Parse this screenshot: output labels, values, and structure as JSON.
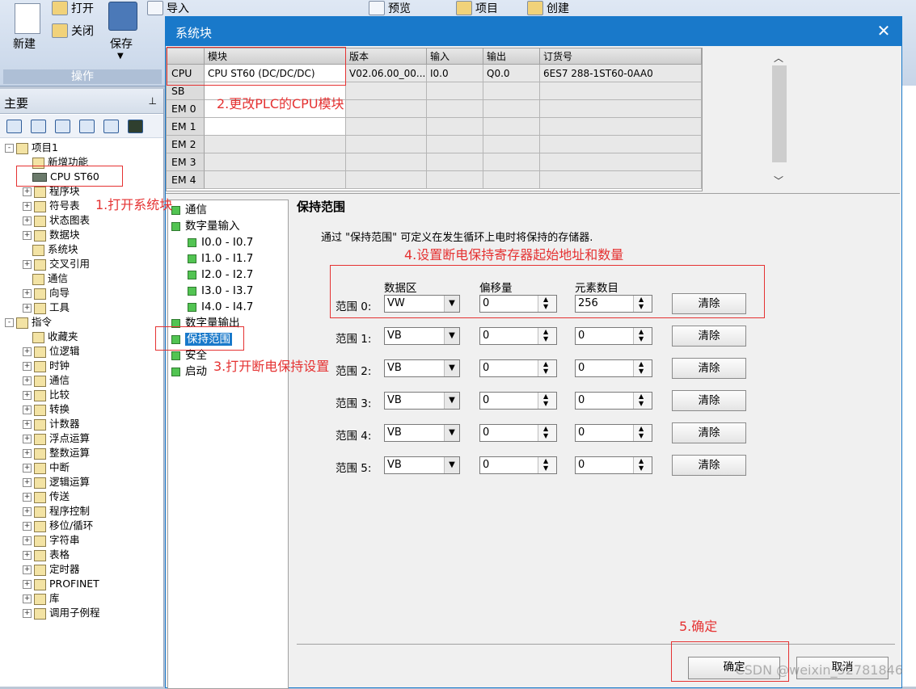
{
  "ribbon": {
    "new_label": "新建",
    "open_label": "打开",
    "close_label": "关闭",
    "save_label": "保存",
    "import_label": "导入",
    "preview_label": "预览",
    "project_label": "项目",
    "create_label": "创建",
    "group_label": "操作"
  },
  "left_panel": {
    "title": "主要",
    "tree": [
      {
        "label": "项目1",
        "indent": 0,
        "exp": "-"
      },
      {
        "label": "新增功能",
        "indent": 2,
        "exp": ""
      },
      {
        "label": "CPU ST60",
        "indent": 2,
        "exp": ""
      },
      {
        "label": "程序块",
        "indent": 1,
        "exp": "+"
      },
      {
        "label": "符号表",
        "indent": 1,
        "exp": "+"
      },
      {
        "label": "状态图表",
        "indent": 1,
        "exp": "+"
      },
      {
        "label": "数据块",
        "indent": 1,
        "exp": "+"
      },
      {
        "label": "系统块",
        "indent": 2,
        "exp": ""
      },
      {
        "label": "交叉引用",
        "indent": 1,
        "exp": "+"
      },
      {
        "label": "通信",
        "indent": 2,
        "exp": ""
      },
      {
        "label": "向导",
        "indent": 1,
        "exp": "+"
      },
      {
        "label": "工具",
        "indent": 1,
        "exp": "+"
      },
      {
        "label": "指令",
        "indent": 0,
        "exp": "-"
      },
      {
        "label": "收藏夹",
        "indent": 2,
        "exp": ""
      },
      {
        "label": "位逻辑",
        "indent": 1,
        "exp": "+"
      },
      {
        "label": "时钟",
        "indent": 1,
        "exp": "+"
      },
      {
        "label": "通信",
        "indent": 1,
        "exp": "+"
      },
      {
        "label": "比较",
        "indent": 1,
        "exp": "+"
      },
      {
        "label": "转换",
        "indent": 1,
        "exp": "+"
      },
      {
        "label": "计数器",
        "indent": 1,
        "exp": "+"
      },
      {
        "label": "浮点运算",
        "indent": 1,
        "exp": "+"
      },
      {
        "label": "整数运算",
        "indent": 1,
        "exp": "+"
      },
      {
        "label": "中断",
        "indent": 1,
        "exp": "+"
      },
      {
        "label": "逻辑运算",
        "indent": 1,
        "exp": "+"
      },
      {
        "label": "传送",
        "indent": 1,
        "exp": "+"
      },
      {
        "label": "程序控制",
        "indent": 1,
        "exp": "+"
      },
      {
        "label": "移位/循环",
        "indent": 1,
        "exp": "+"
      },
      {
        "label": "字符串",
        "indent": 1,
        "exp": "+"
      },
      {
        "label": "表格",
        "indent": 1,
        "exp": "+"
      },
      {
        "label": "定时器",
        "indent": 1,
        "exp": "+"
      },
      {
        "label": "PROFINET",
        "indent": 1,
        "exp": "+"
      },
      {
        "label": "库",
        "indent": 1,
        "exp": "+"
      },
      {
        "label": "调用子例程",
        "indent": 1,
        "exp": "+"
      }
    ]
  },
  "dialog": {
    "title": "系统块",
    "grid": {
      "headers": [
        "模块",
        "版本",
        "输入",
        "输出",
        "订货号"
      ],
      "rows": [
        {
          "slot": "CPU",
          "cells": [
            "CPU ST60 (DC/DC/DC)",
            "V02.06.00_00....",
            "I0.0",
            "Q0.0",
            "6ES7 288-1ST60-0AA0"
          ]
        },
        {
          "slot": "SB",
          "cells": [
            "",
            "",
            "",
            "",
            ""
          ]
        },
        {
          "slot": "EM 0",
          "cells": [
            "",
            "",
            "",
            "",
            ""
          ]
        },
        {
          "slot": "EM 1",
          "cells": [
            "",
            "",
            "",
            "",
            ""
          ]
        },
        {
          "slot": "EM 2",
          "cells": [
            "",
            "",
            "",
            "",
            ""
          ]
        },
        {
          "slot": "EM 3",
          "cells": [
            "",
            "",
            "",
            "",
            ""
          ]
        },
        {
          "slot": "EM 4",
          "cells": [
            "",
            "",
            "",
            "",
            ""
          ]
        }
      ]
    },
    "nav": [
      {
        "label": "通信",
        "level": 0,
        "selected": false
      },
      {
        "label": "数字量输入",
        "level": 0,
        "selected": false
      },
      {
        "label": "I0.0 - I0.7",
        "level": 1,
        "selected": false
      },
      {
        "label": "I1.0 - I1.7",
        "level": 1,
        "selected": false
      },
      {
        "label": "I2.0 - I2.7",
        "level": 1,
        "selected": false
      },
      {
        "label": "I3.0 - I3.7",
        "level": 1,
        "selected": false
      },
      {
        "label": "I4.0 - I4.7",
        "level": 1,
        "selected": false
      },
      {
        "label": "数字量输出",
        "level": 0,
        "selected": false
      },
      {
        "label": "保持范围",
        "level": 0,
        "selected": true
      },
      {
        "label": "安全",
        "level": 0,
        "selected": false
      },
      {
        "label": "启动",
        "level": 0,
        "selected": false
      }
    ],
    "content": {
      "title": "保持范围",
      "description": "通过 \"保持范围\" 可定义在发生循环上电时将保持的存储器.",
      "col_area": "数据区",
      "col_offset": "偏移量",
      "col_count": "元素数目",
      "clear_label": "清除",
      "ranges": [
        {
          "label": "范围 0:",
          "area": "VW",
          "offset": "0",
          "count": "256"
        },
        {
          "label": "范围 1:",
          "area": "VB",
          "offset": "0",
          "count": "0"
        },
        {
          "label": "范围 2:",
          "area": "VB",
          "offset": "0",
          "count": "0"
        },
        {
          "label": "范围 3:",
          "area": "VB",
          "offset": "0",
          "count": "0"
        },
        {
          "label": "范围 4:",
          "area": "VB",
          "offset": "0",
          "count": "0"
        },
        {
          "label": "范围 5:",
          "area": "VB",
          "offset": "0",
          "count": "0"
        }
      ]
    },
    "ok_label": "确定",
    "cancel_label": "取消"
  },
  "annotations": {
    "step1": "1.打开系统块",
    "step2": "2.更改PLC的CPU模块",
    "step3": "3.打开断电保持设置",
    "step4": "4.设置断电保持寄存器起始地址和数量",
    "step5": "5.确定",
    "color": "#e53232"
  },
  "watermark": "CSDN @weixin_52781846",
  "colors": {
    "title_bar": "#1979ca",
    "selection": "#1979ca",
    "node_green": "#52c452"
  }
}
